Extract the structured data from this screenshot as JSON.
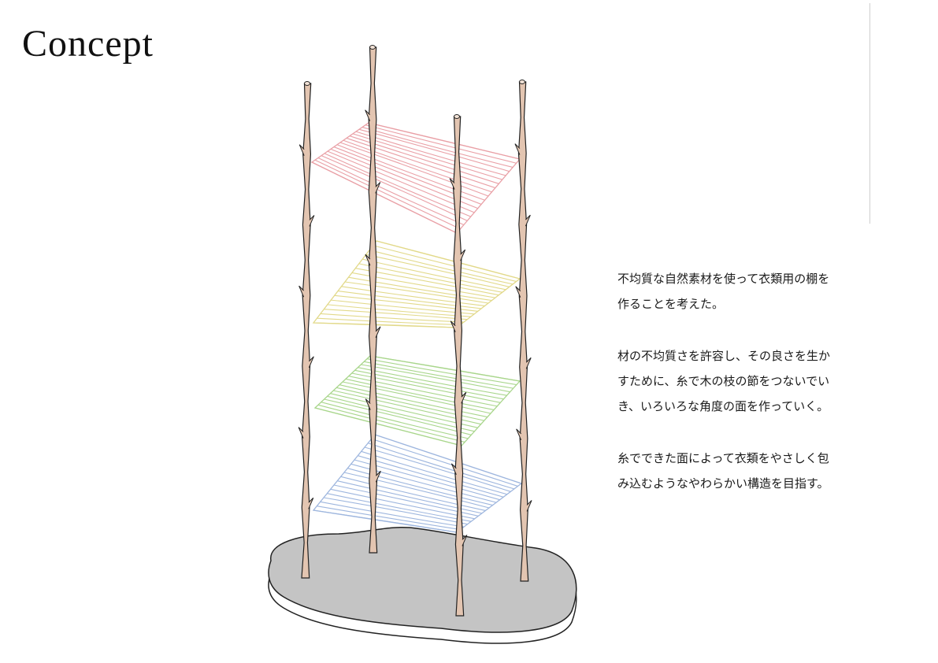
{
  "page": {
    "title": "Concept"
  },
  "illustration": {
    "subject": "shelf of branches with thread-woven shelves",
    "shelf_colors": [
      "#e9a0a6",
      "#e2d98a",
      "#a9d68c",
      "#9eb6de"
    ],
    "base_color": "#c4c4c4",
    "branch_color": "#e3c5b1"
  },
  "description": {
    "paragraphs": [
      [
        "不均質な自然素材を使って衣類用の棚を",
        "作ることを考えた。"
      ],
      [
        "材の不均質さを許容し、その良さを生か",
        "すために、糸で木の枝の節をつないでい",
        "き、いろいろな角度の面を作っていく。"
      ],
      [
        "糸でできた面によって衣類をやさしく包",
        "み込むようなやわらかい構造を目指す。"
      ]
    ]
  }
}
